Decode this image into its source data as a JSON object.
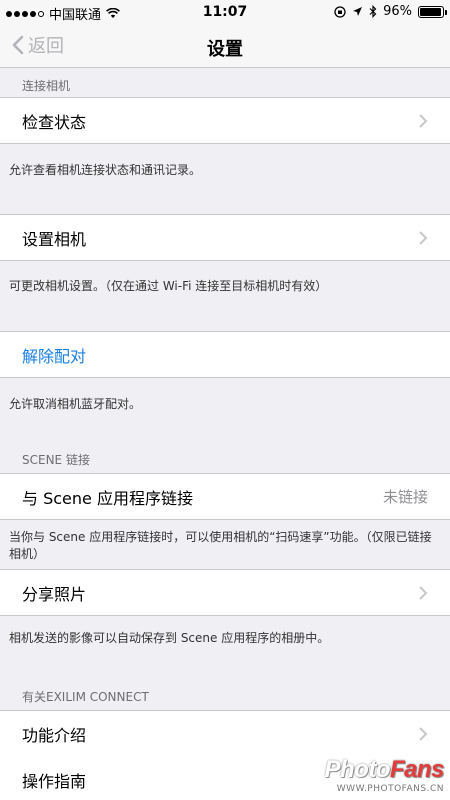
{
  "status_bar": {
    "carrier": "中国联通",
    "time": "11:07",
    "battery": "96%",
    "battery_level": 0.96
  },
  "nav": {
    "back_label": "返回",
    "title": "设置"
  },
  "sections": {
    "connect_header": "连接相机",
    "check_status": "检查状态",
    "check_status_footer": "允许查看相机连接状态和通讯记录。",
    "setup_camera": "设置相机",
    "setup_camera_footer": "可更改相机设置。（仅在通过 Wi-Fi 连接至目标相机时有效）",
    "unpair": "解除配对",
    "unpair_footer": "允许取消相机蓝牙配对。",
    "scene_header": "SCENE 链接",
    "scene_link": "与 Scene 应用程序链接",
    "scene_link_value": "未链接",
    "scene_link_footer": "当你与 Scene 应用程序链接时，可以使用相机的“扫码速享”功能。（仅限已链接相机）",
    "share_photos": "分享照片",
    "share_photos_footer": "相机发送的影像可以自动保存到 Scene 应用程序的相册中。",
    "about_header": "有关EXILIM CONNECT",
    "features": "功能介绍",
    "guide": "操作指南"
  },
  "watermark": {
    "brand_a": "Photo",
    "brand_b": "Fans",
    "url": "WWW.PHOTOFANS.CN"
  },
  "colors": {
    "accent": "#1a7fe3",
    "background": "#efeff4"
  }
}
